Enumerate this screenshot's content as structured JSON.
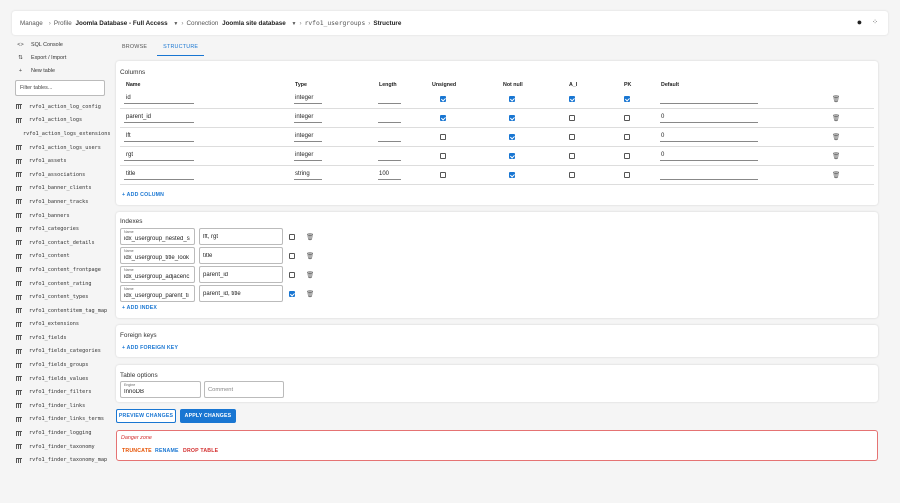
{
  "breadcrumb": {
    "manage": "Manage",
    "profile_label": "Profile",
    "profile_value": "Joomla Database - Full Access",
    "connection_label": "Connection",
    "connection_value": "Joomla site database",
    "table": "rvfo1_usergroups",
    "current": "Structure",
    "separator": "›"
  },
  "top_icons": {
    "account": "account-circle-icon",
    "settings": "settings-icon"
  },
  "sidebar": {
    "links": [
      {
        "label": "SQL Console",
        "icon": "<>"
      },
      {
        "label": "Export / Import",
        "icon": "⇅"
      },
      {
        "label": "New table",
        "icon": "+"
      }
    ],
    "filter_placeholder": "Filter tables...",
    "tables": [
      "rvfo1_action_log_config",
      "rvfo1_action_logs",
      "rvfo1_action_logs_extensions",
      "rvfo1_action_logs_users",
      "rvfo1_assets",
      "rvfo1_associations",
      "rvfo1_banner_clients",
      "rvfo1_banner_tracks",
      "rvfo1_banners",
      "rvfo1_categories",
      "rvfo1_contact_details",
      "rvfo1_content",
      "rvfo1_content_frontpage",
      "rvfo1_content_rating",
      "rvfo1_content_types",
      "rvfo1_contentitem_tag_map",
      "rvfo1_extensions",
      "rvfo1_fields",
      "rvfo1_fields_categories",
      "rvfo1_fields_groups",
      "rvfo1_fields_values",
      "rvfo1_finder_filters",
      "rvfo1_finder_links",
      "rvfo1_finder_links_terms",
      "rvfo1_finder_logging",
      "rvfo1_finder_taxonomy",
      "rvfo1_finder_taxonomy_map"
    ]
  },
  "tabs": [
    "BROWSE",
    "STRUCTURE"
  ],
  "columns": {
    "title": "Columns",
    "headers": [
      "Name",
      "Type",
      "Length",
      "Unsigned",
      "Not null",
      "A_I",
      "PK",
      "Default"
    ],
    "rows": [
      {
        "name": "id",
        "type": "integer",
        "length": "",
        "unsigned": true,
        "not_null": true,
        "ai": true,
        "pk": true,
        "default": ""
      },
      {
        "name": "parent_id",
        "type": "integer",
        "length": "",
        "unsigned": true,
        "not_null": true,
        "ai": false,
        "pk": false,
        "default": "0"
      },
      {
        "name": "lft",
        "type": "integer",
        "length": "",
        "unsigned": false,
        "not_null": true,
        "ai": false,
        "pk": false,
        "default": "0"
      },
      {
        "name": "rgt",
        "type": "integer",
        "length": "",
        "unsigned": false,
        "not_null": true,
        "ai": false,
        "pk": false,
        "default": "0"
      },
      {
        "name": "title",
        "type": "string",
        "length": "100",
        "unsigned": false,
        "not_null": true,
        "ai": false,
        "pk": false,
        "default": ""
      }
    ],
    "add_label": "+ ADD COLUMN"
  },
  "indexes": {
    "title": "Indexes",
    "name_label": "Name",
    "rows": [
      {
        "name": "idx_usergroup_nested_s",
        "columns": "lft, rgt",
        "unique": false
      },
      {
        "name": "idx_usergroup_title_look",
        "columns": "title",
        "unique": false
      },
      {
        "name": "idx_usergroup_adjacenc",
        "columns": "parent_id",
        "unique": false
      },
      {
        "name": "idx_usergroup_parent_ti",
        "columns": "parent_id, title",
        "unique": true
      }
    ],
    "add_label": "+ ADD INDEX"
  },
  "foreign_keys": {
    "title": "Foreign keys",
    "add_label": "+ ADD FOREIGN KEY"
  },
  "table_options": {
    "title": "Table options",
    "engine_label": "Engine",
    "engine_value": "InnoDB",
    "comment_placeholder": "Comment"
  },
  "actions": {
    "preview": "PREVIEW CHANGES",
    "apply": "APPLY CHANGES"
  },
  "danger_zone": {
    "title": "Danger zone",
    "truncate": "TRUNCATE",
    "rename": "RENAME",
    "drop": "DROP TABLE",
    "colors": {
      "truncate": "#e65100",
      "rename": "#1976d2",
      "drop": "#d32f2f"
    }
  },
  "colors": {
    "accent": "#1976d2",
    "danger": "#d32f2f"
  }
}
